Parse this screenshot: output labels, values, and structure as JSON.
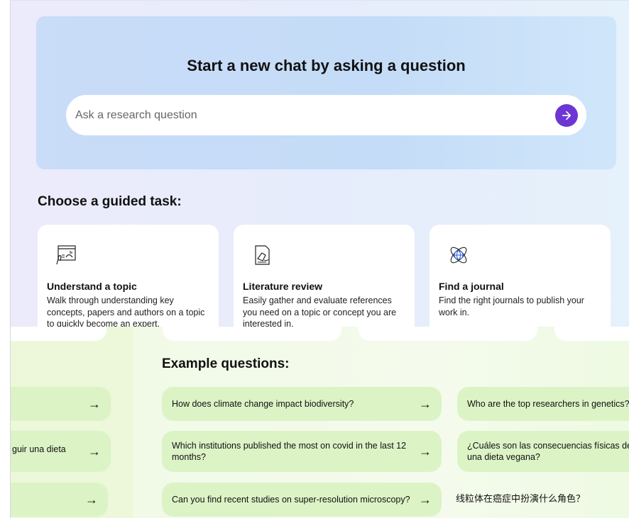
{
  "hero": {
    "title": "Start a new chat by asking a question",
    "search_placeholder": "Ask a research question",
    "send_icon": "arrow-right-icon",
    "accent_color": "#6d36d4"
  },
  "guided": {
    "heading": "Choose a guided task:",
    "cards": [
      {
        "icon": "browser-chart-icon",
        "title": "Understand a topic",
        "description": "Walk through understanding key concepts, papers and authors on a topic to quickly become an expert."
      },
      {
        "icon": "document-hand-icon",
        "title": "Literature review",
        "description": "Easily gather and evaluate references you need on a topic or concept you are interested in."
      },
      {
        "icon": "atom-globe-icon",
        "title": "Find a journal",
        "description": "Find the right journals to publish your work in."
      }
    ]
  },
  "examples": {
    "heading": "Example questions:",
    "left_partial": [
      "",
      "guir una dieta",
      ""
    ],
    "center": [
      "How does climate change impact biodiversity?",
      "Which institutions published the most on covid in the last 12 months?",
      "Can you find recent studies on super-resolution microscopy?"
    ],
    "right": [
      "Who are the top researchers in genetics?",
      "¿Cuáles son las consecuencias físicas de seguir una dieta vegana?",
      "线粒体在癌症中扮演什么角色？"
    ]
  }
}
